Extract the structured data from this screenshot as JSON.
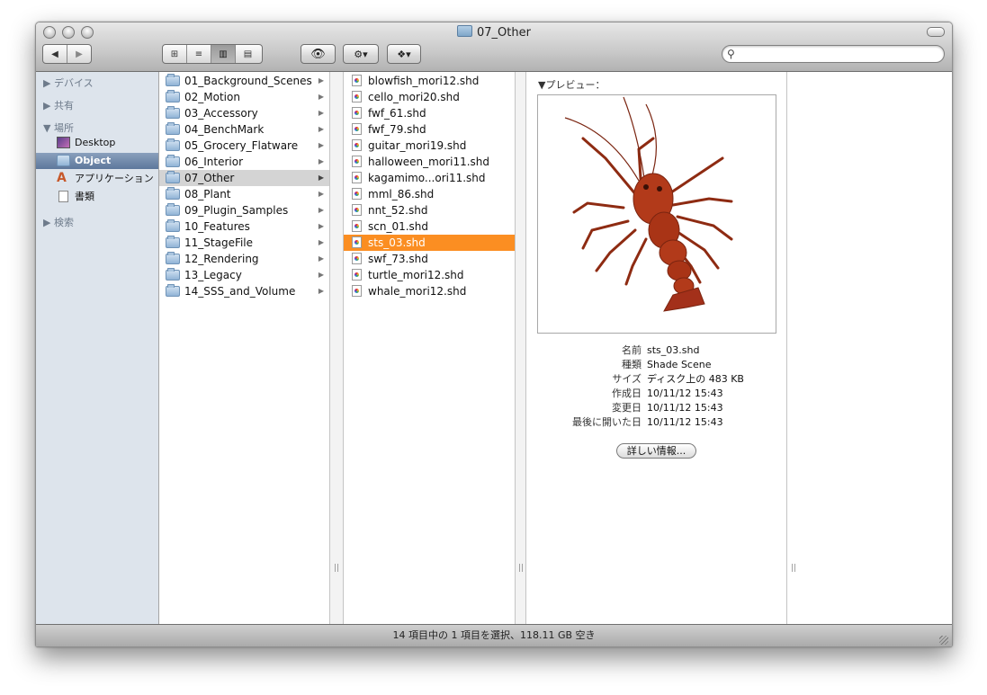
{
  "window": {
    "title": "07_Other"
  },
  "toolbar": {
    "back_label": "◀",
    "forward_label": "▶",
    "view_icons": "⊞",
    "view_list": "≡",
    "view_columns": "▥",
    "view_coverflow": "▤",
    "quicklook_label": "👁",
    "action_label": "⚙▾",
    "dropbox_label": "❖▾",
    "search_placeholder": ""
  },
  "sidebar": {
    "devices": "▶ デバイス",
    "shared": "▶ 共有",
    "places": "▼ 場所",
    "places_items": [
      {
        "label": "Desktop",
        "icon": "desktop-icon"
      },
      {
        "label": "Object",
        "icon": "folder-icon",
        "selected": true
      },
      {
        "label": "アプリケーション",
        "icon": "applications-icon"
      },
      {
        "label": "書類",
        "icon": "documents-icon"
      }
    ],
    "search": "▶ 検索"
  },
  "column1": {
    "items": [
      "01_Background_Scenes",
      "02_Motion",
      "03_Accessory",
      "04_BenchMark",
      "05_Grocery_Flatware",
      "06_Interior",
      "07_Other",
      "08_Plant",
      "09_Plugin_Samples",
      "10_Features",
      "11_StageFile",
      "12_Rendering",
      "13_Legacy",
      "14_SSS_and_Volume"
    ],
    "selected_index": 6
  },
  "column2": {
    "items": [
      "blowfish_mori12.shd",
      "cello_mori20.shd",
      "fwf_61.shd",
      "fwf_79.shd",
      "guitar_mori19.shd",
      "halloween_mori11.shd",
      "kagamimo...ori11.shd",
      "mml_86.shd",
      "nnt_52.shd",
      "scn_01.shd",
      "sts_03.shd",
      "swf_73.shd",
      "turtle_mori12.shd",
      "whale_mori12.shd"
    ],
    "selected_index": 10
  },
  "preview": {
    "label": "▼プレビュー：",
    "info": [
      {
        "key": "名前",
        "value": "sts_03.shd"
      },
      {
        "key": "種類",
        "value": "Shade Scene"
      },
      {
        "key": "サイズ",
        "value": "ディスク上の 483 KB"
      },
      {
        "key": "作成日",
        "value": "10/11/12 15:43"
      },
      {
        "key": "変更日",
        "value": "10/11/12 15:43"
      },
      {
        "key": "最後に開いた日",
        "value": "10/11/12 15:43"
      }
    ],
    "more_info_button": "詳しい情報..."
  },
  "status": {
    "text": "14 項目中の 1 項目を選択、118.11 GB 空き"
  },
  "colors": {
    "selection_orange": "#fb8e22",
    "sidebar_bg": "#dde4ec",
    "lobster": "#b23a1a"
  }
}
